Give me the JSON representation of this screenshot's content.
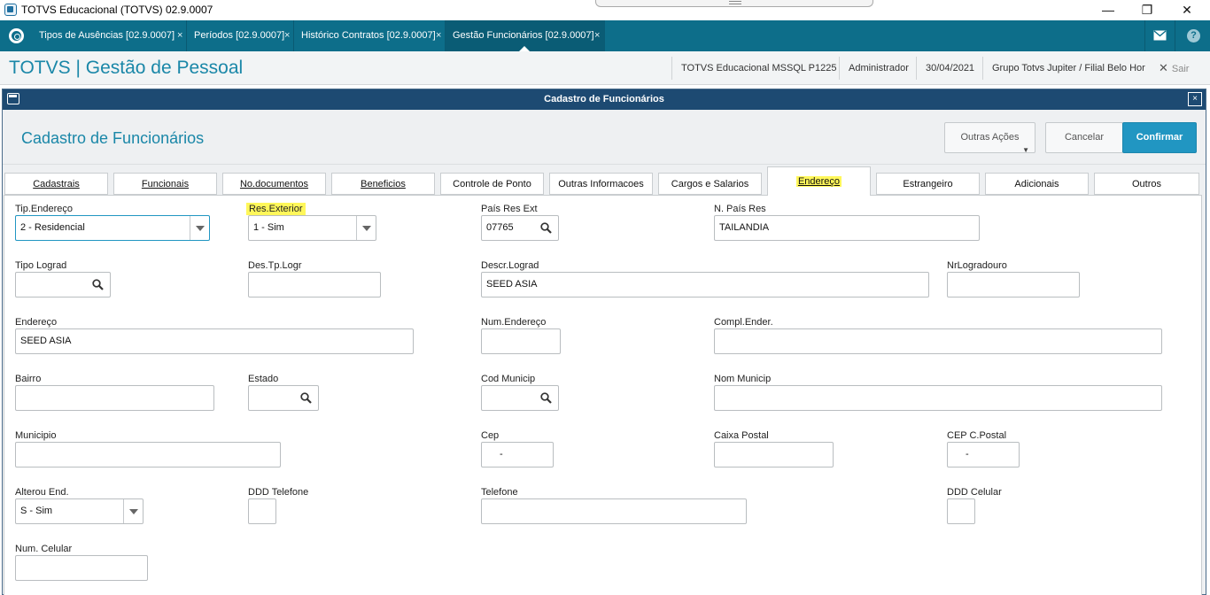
{
  "window": {
    "title": "TOTVS Educacional (TOTVS) 02.9.0007",
    "min": "—",
    "max": "❐",
    "close": "✕"
  },
  "tabs": [
    {
      "label": "Tipos de Ausências [02.9.0007]",
      "close": "×"
    },
    {
      "label": "Períodos [02.9.0007]",
      "close": "×"
    },
    {
      "label": "Histórico Contratos [02.9.0007]",
      "close": "×"
    },
    {
      "label": "Gestão Funcionários [02.9.0007]",
      "close": "×"
    }
  ],
  "topbar": {
    "help": "?"
  },
  "header": {
    "brand": "TOTVS | Gestão de Pessoal",
    "database": "TOTVS Educacional MSSQL P1225",
    "user": "Administrador",
    "date": "30/04/2021",
    "company": "Grupo Totvs Jupiter / Filial Belo Hor",
    "exit": "Sair",
    "exit_icon": "✕"
  },
  "dialog": {
    "title": "Cadastro de Funcionários",
    "close": "×",
    "heading": "Cadastro de Funcionários",
    "buttons": {
      "more": "Outras Ações",
      "more_caret": "▼",
      "cancel": "Cancelar",
      "confirm": "Confirmar"
    }
  },
  "folder_tabs": [
    "Cadastrais",
    "Funcionais",
    "No.documentos",
    "Beneficios",
    "Controle de Ponto",
    "Outras Informacoes",
    "Cargos e Salarios",
    "Endereço",
    "Estrangeiro",
    "Adicionais",
    "Outros"
  ],
  "active_folder_tab": "Endereço",
  "form": {
    "tip_endereco": {
      "label": "Tip.Endereço",
      "value": "2 - Residencial"
    },
    "res_exterior": {
      "label": "Res.Exterior",
      "value": "1 - Sim"
    },
    "pais_res_ext": {
      "label": "País Res Ext",
      "value": "07765"
    },
    "n_pais_res": {
      "label": "N. País Res",
      "value": "TAILANDIA"
    },
    "tipo_lograd": {
      "label": "Tipo Lograd",
      "value": ""
    },
    "des_tp_logr": {
      "label": "Des.Tp.Logr",
      "value": ""
    },
    "descr_lograd": {
      "label": "Descr.Lograd",
      "value": "SEED ASIA"
    },
    "nr_logradouro": {
      "label": "NrLogradouro",
      "value": ""
    },
    "endereco": {
      "label": "Endereço",
      "value": "SEED ASIA"
    },
    "num_endereco": {
      "label": "Num.Endereço",
      "value": ""
    },
    "compl_ender": {
      "label": "Compl.Ender.",
      "value": ""
    },
    "bairro": {
      "label": "Bairro",
      "value": ""
    },
    "estado": {
      "label": "Estado",
      "value": ""
    },
    "cod_municip": {
      "label": "Cod Municip",
      "value": ""
    },
    "nom_municip": {
      "label": "Nom Municip",
      "value": ""
    },
    "municipio": {
      "label": "Municipio",
      "value": ""
    },
    "cep": {
      "label": "Cep",
      "value": "-"
    },
    "caixa_postal": {
      "label": "Caixa Postal",
      "value": ""
    },
    "cep_c_postal": {
      "label": "CEP C.Postal",
      "value": "-"
    },
    "alterou_end": {
      "label": "Alterou End.",
      "value": "S - Sim"
    },
    "ddd_telefone": {
      "label": "DDD Telefone",
      "value": ""
    },
    "telefone": {
      "label": "Telefone",
      "value": ""
    },
    "ddd_celular": {
      "label": "DDD Celular",
      "value": ""
    },
    "num_celular": {
      "label": "Num. Celular",
      "value": ""
    }
  }
}
